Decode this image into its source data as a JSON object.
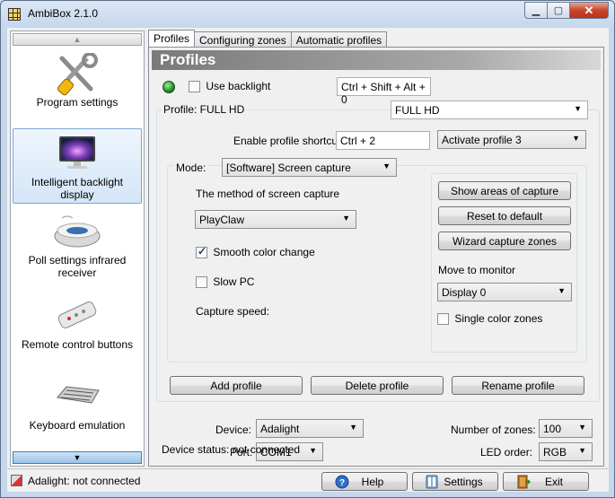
{
  "window": {
    "title": "AmbiBox 2.1.0"
  },
  "sidebar": {
    "items": [
      {
        "label": "Program settings",
        "icon": "tools-icon"
      },
      {
        "label": "Intelligent backlight display",
        "icon": "monitor-icon"
      },
      {
        "label": "Poll settings infrared receiver",
        "icon": "ir-receiver-icon"
      },
      {
        "label": "Remote control buttons",
        "icon": "remote-control-icon"
      },
      {
        "label": "Keyboard emulation",
        "icon": "keyboard-icon"
      }
    ]
  },
  "tabs": [
    {
      "label": "Profiles",
      "active": true
    },
    {
      "label": "Configuring zones",
      "active": false
    },
    {
      "label": "Automatic profiles",
      "active": false
    }
  ],
  "profiles": {
    "header": "Profiles",
    "use_backlight_label": "Use backlight",
    "use_backlight_checked": false,
    "backlight_shortcut": "Ctrl + Shift + Alt + 0",
    "profile_label": "Profile: FULL HD",
    "profile_value": "FULL HD",
    "enable_shortcut_label": "Enable profile shortcut:",
    "enable_shortcut_value": "Ctrl + 2",
    "activate_profile_value": "Activate profile 3",
    "mode_label": "Mode:",
    "mode_value": "[Software] Screen capture",
    "capture_method_label": "The method of screen capture",
    "capture_method_value": "PlayClaw",
    "smooth_color_label": "Smooth color change",
    "smooth_color_checked": true,
    "slow_pc_label": "Slow PC",
    "slow_pc_checked": false,
    "capture_speed_label": "Capture speed:",
    "show_areas_button": "Show areas of capture",
    "reset_default_button": "Reset to default",
    "wizard_zones_button": "Wizard capture zones",
    "move_monitor_label": "Move to monitor",
    "monitor_value": "Display 0",
    "single_color_label": "Single color zones",
    "single_color_checked": false,
    "add_profile_button": "Add profile",
    "delete_profile_button": "Delete profile",
    "rename_profile_button": "Rename profile"
  },
  "device": {
    "device_label": "Device:",
    "device_value": "Adalight",
    "port_label": "Port:",
    "port_value": "COM1",
    "zones_label": "Number of zones:",
    "zones_value": "100",
    "led_order_label": "LED order:",
    "led_order_value": "RGB",
    "status_text": "Device status: not connected"
  },
  "statusbar": {
    "text": "Adalight: not connected",
    "help_button": "Help",
    "settings_button": "Settings",
    "exit_button": "Exit"
  },
  "colors": {
    "led_green": "#1d8f1f",
    "title_bg": "#c6d7ec",
    "section_header": "#7a7a7a"
  }
}
